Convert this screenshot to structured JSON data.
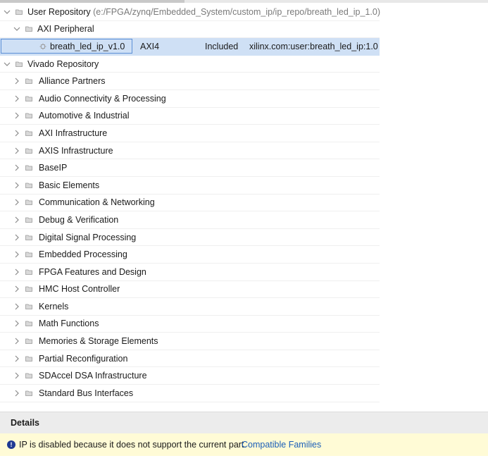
{
  "tree": {
    "user_repo": {
      "label": "User Repository",
      "path": "(e:/FPGA/zynq/Embedded_System/custom_ip/ip_repo/breath_led_ip_1.0)",
      "axi_peripheral": {
        "label": "AXI Peripheral",
        "ip": {
          "name": "breath_led_ip_v1.0",
          "interface": "AXI4",
          "status": "Included",
          "vlnv": "xilinx.com:user:breath_led_ip:1.0"
        }
      }
    },
    "vivado_repo": {
      "label": "Vivado Repository",
      "categories": [
        "Alliance Partners",
        "Audio Connectivity & Processing",
        "Automotive & Industrial",
        "AXI Infrastructure",
        "AXIS Infrastructure",
        "BaseIP",
        "Basic Elements",
        "Communication & Networking",
        "Debug & Verification",
        "Digital Signal Processing",
        "Embedded Processing",
        "FPGA Features and Design",
        "HMC Host Controller",
        "Kernels",
        "Math Functions",
        "Memories & Storage Elements",
        "Partial Reconfiguration",
        "SDAccel DSA Infrastructure",
        "Standard Bus Interfaces"
      ]
    }
  },
  "details": {
    "title": "Details",
    "message": "IP is disabled because it does not support the current part.",
    "link": "Compatible Families"
  },
  "icons": {
    "expanded": "chevron-down-icon",
    "collapsed": "chevron-right-icon",
    "folder": "folder-icon",
    "ip": "ip-block-icon",
    "warning": "info-circle-icon"
  },
  "colors": {
    "selection": "#cfe0f5",
    "selection_border": "#5b8fd6",
    "link": "#1b5fb8",
    "message_bg": "#fffbd6",
    "path_text": "#7a7a7a"
  }
}
